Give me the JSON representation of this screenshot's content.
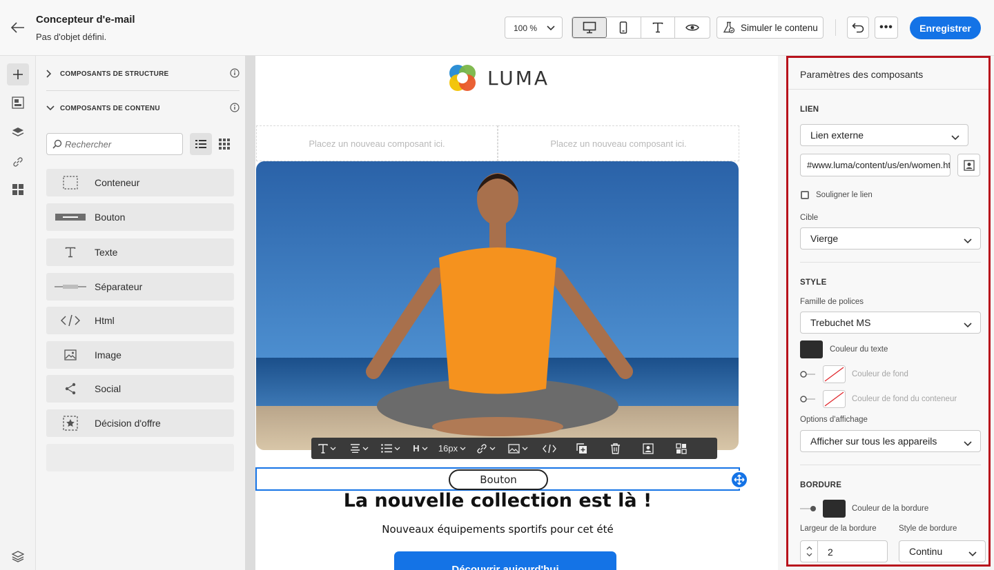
{
  "header": {
    "title": "Concepteur d'e-mail",
    "subtitle": "Pas d'objet défini.",
    "zoom": "100 %",
    "simulate_label": "Simuler le contenu",
    "save_label": "Enregistrer",
    "more_label": "•••"
  },
  "components_panel": {
    "structure_section": "COMPOSANTS DE STRUCTURE",
    "content_section": "COMPOSANTS DE CONTENU",
    "search_placeholder": "Rechercher",
    "items": [
      {
        "label": "Conteneur",
        "icon": "container-icon"
      },
      {
        "label": "Bouton",
        "icon": "button-icon"
      },
      {
        "label": "Texte",
        "icon": "text-icon"
      },
      {
        "label": "Séparateur",
        "icon": "divider-icon"
      },
      {
        "label": "Html",
        "icon": "code-icon"
      },
      {
        "label": "Image",
        "icon": "image-icon"
      },
      {
        "label": "Social",
        "icon": "share-icon"
      },
      {
        "label": "Décision d'offre",
        "icon": "offer-decision-icon"
      }
    ]
  },
  "canvas": {
    "logo_text": "LUMA",
    "placeholder_left": "Placez un nouveau composant ici.",
    "placeholder_right": "Placez un nouveau composant ici.",
    "toolbar": {
      "heading": "H",
      "font_size": "16px"
    },
    "selected_button_label": "Bouton",
    "headline": "La nouvelle collection est là !",
    "subline": "Nouveaux équipements sportifs pour cet été",
    "cta_label": "Découvrir aujourd'hui"
  },
  "settings_panel": {
    "title": "Paramètres des composants",
    "link_section": "LIEN",
    "link_type": "Lien externe",
    "link_url": "#www.luma/content/us/en/women.html",
    "underline_label": "Souligner le lien",
    "target_label": "Cible",
    "target_value": "Vierge",
    "style_section": "STYLE",
    "font_family_label": "Famille de polices",
    "font_family_value": "Trebuchet MS",
    "text_color_label": "Couleur du texte",
    "bg_color_label": "Couleur de fond",
    "container_bg_label": "Couleur de fond du conteneur",
    "display_options_label": "Options d'affichage",
    "display_options_value": "Afficher sur tous les appareils",
    "border_section": "BORDURE",
    "border_color_label": "Couleur de la bordure",
    "border_width_label": "Largeur de la bordure",
    "border_width_value": "2",
    "border_style_label": "Style de bordure",
    "border_style_value": "Continu"
  },
  "colors": {
    "accent": "#1473e6",
    "highlight_border": "#b8121c",
    "text_swatch": "#2c2c2c",
    "border_swatch": "#2c2c2c"
  }
}
